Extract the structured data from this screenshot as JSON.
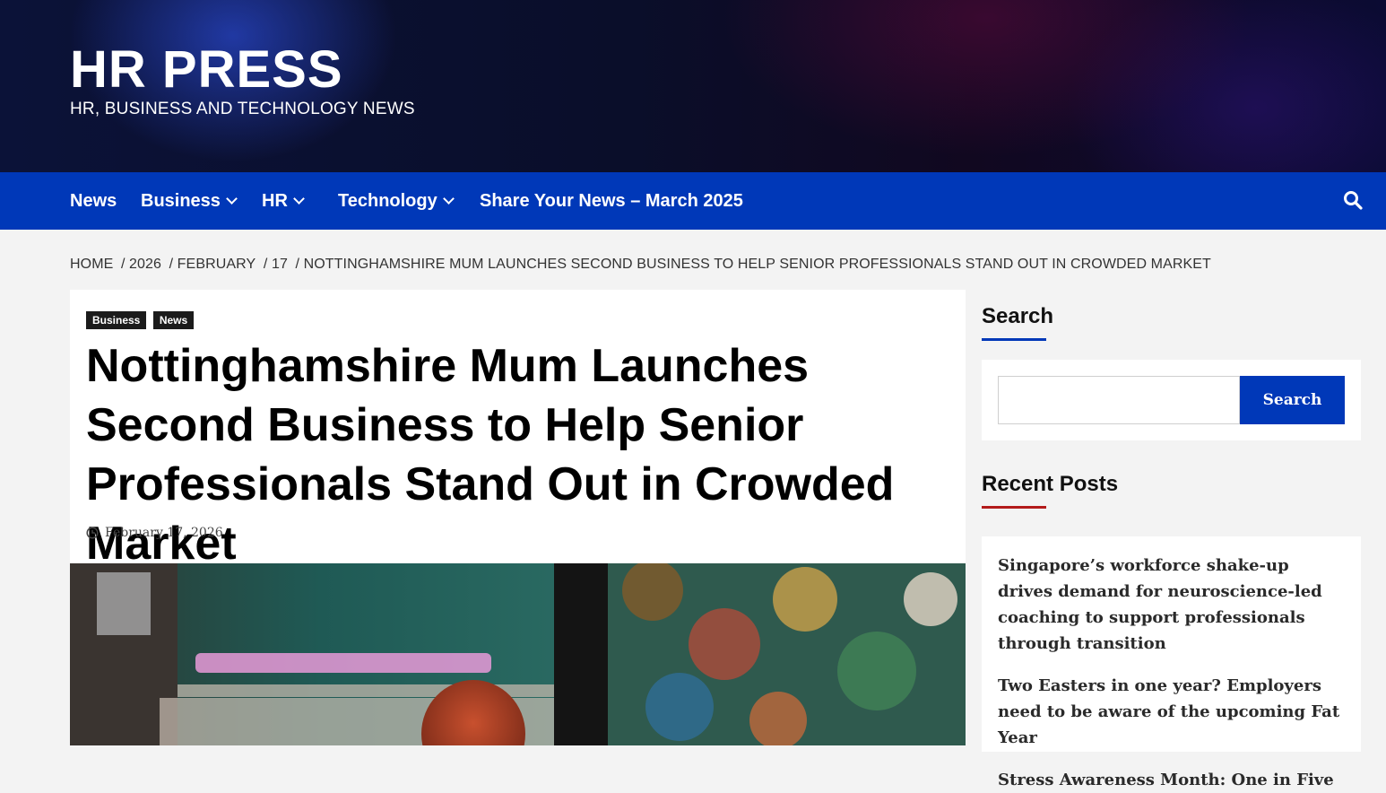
{
  "site": {
    "title": "HR PRESS",
    "tagline": "HR, BUSINESS AND TECHNOLOGY NEWS"
  },
  "nav": {
    "items": [
      {
        "label": "News",
        "has_dropdown": false
      },
      {
        "label": "Business",
        "has_dropdown": true
      },
      {
        "label": "HR",
        "has_dropdown": true
      },
      {
        "label": "Technology",
        "has_dropdown": true
      },
      {
        "label": "Share Your News – March 2025",
        "has_dropdown": false
      }
    ],
    "search_icon": "search-icon"
  },
  "breadcrumb": {
    "items": [
      "HOME",
      "/ 2026",
      "/ FEBRUARY",
      "/ 17",
      "/ NOTTINGHAMSHIRE MUM LAUNCHES SECOND BUSINESS TO HELP SENIOR PROFESSIONALS STAND OUT IN CROWDED MARKET"
    ]
  },
  "article": {
    "categories": [
      "Business",
      "News"
    ],
    "title": "Nottinghamshire Mum Launches Second Business to Help Senior Professionals Stand Out in Crowded Market",
    "date": "February 17, 2026",
    "date_icon": "clock-icon"
  },
  "sidebar": {
    "search": {
      "title": "Search",
      "placeholder": "",
      "button_label": "Search"
    },
    "recent": {
      "title": "Recent Posts",
      "items": [
        "Singapore’s workforce shake-up drives demand for neuroscience-led coaching to support professionals through transition",
        "Two Easters in one year? Employers need to be aware of the upcoming Fat Year",
        "Stress Awareness Month: One in Five"
      ]
    }
  },
  "colors": {
    "nav_bg": "#0038b8",
    "search_accent": "#0038b8",
    "recent_accent": "#b31b1b",
    "category_bg": "#1b1b1b"
  }
}
